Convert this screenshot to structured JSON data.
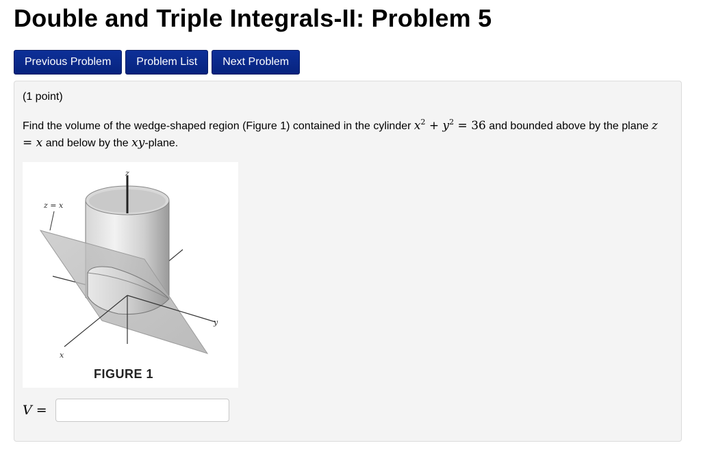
{
  "page": {
    "title": "Double and Triple Integrals-II: Problem 5"
  },
  "nav": {
    "previous_label": "Previous Problem",
    "list_label": "Problem List",
    "next_label": "Next Problem"
  },
  "problem": {
    "points": "(1 point)",
    "text_1": "Find the volume of the wedge-shaped region (Figure 1) contained in the cylinder ",
    "cyl_x": "x",
    "cyl_plus": " + ",
    "cyl_y": "y",
    "exp": "2",
    "cyl_eq": " = 36",
    "text_2": " and bounded above by the plane ",
    "plane_z": "z",
    "plane_eq": " = ",
    "plane_x": "x",
    "text_3": " and below by the ",
    "xy": "xy",
    "text_4": "-plane."
  },
  "figure": {
    "caption": "FIGURE 1",
    "axis_z": "z",
    "axis_y": "y",
    "axis_x": "x",
    "plane_label": "z = x"
  },
  "answer": {
    "label_var": "V",
    "label_eq": " =",
    "value": "",
    "placeholder": ""
  },
  "colors": {
    "button_bg": "#0a2a8c",
    "panel_bg": "#f4f4f4"
  }
}
